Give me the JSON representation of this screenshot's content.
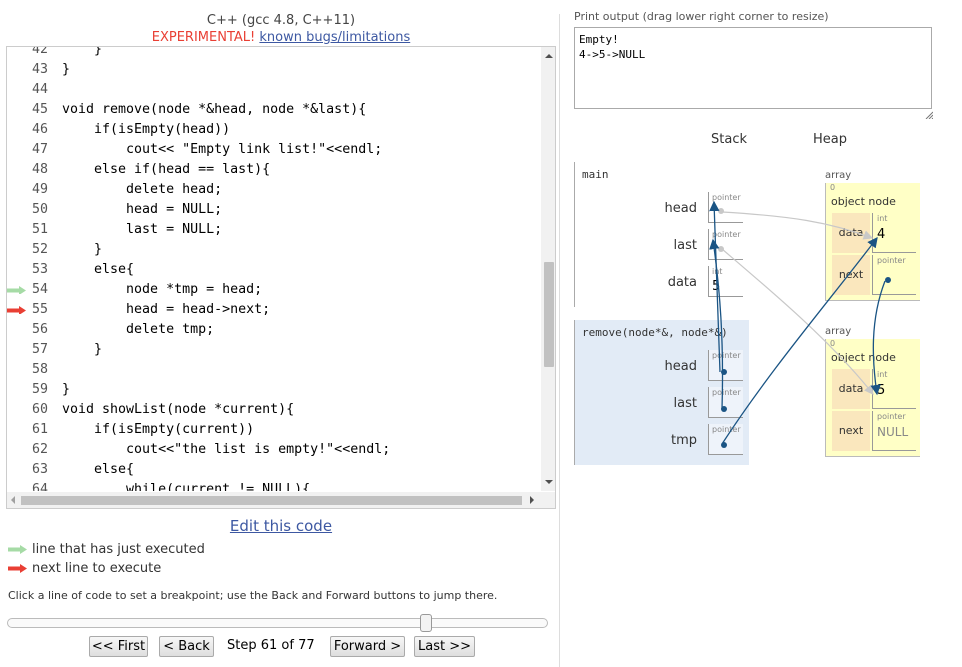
{
  "header": {
    "language": "C++ (gcc 4.8, C++11)",
    "experimental": "EXPERIMENTAL!",
    "bugs_link": "known bugs/limitations"
  },
  "code": {
    "lines": [
      {
        "n": "42",
        "text": "    }",
        "marker": ""
      },
      {
        "n": "43",
        "text": "}",
        "marker": ""
      },
      {
        "n": "44",
        "text": "",
        "marker": ""
      },
      {
        "n": "45",
        "text": "void remove(node *&head, node *&last){",
        "marker": ""
      },
      {
        "n": "46",
        "text": "    if(isEmpty(head))",
        "marker": ""
      },
      {
        "n": "47",
        "text": "        cout<< \"Empty link list!\"<<endl;",
        "marker": ""
      },
      {
        "n": "48",
        "text": "    else if(head == last){",
        "marker": ""
      },
      {
        "n": "49",
        "text": "        delete head;",
        "marker": ""
      },
      {
        "n": "50",
        "text": "        head = NULL;",
        "marker": ""
      },
      {
        "n": "51",
        "text": "        last = NULL;",
        "marker": ""
      },
      {
        "n": "52",
        "text": "    }",
        "marker": ""
      },
      {
        "n": "53",
        "text": "    else{",
        "marker": ""
      },
      {
        "n": "54",
        "text": "        node *tmp = head;",
        "marker": "just"
      },
      {
        "n": "55",
        "text": "        head = head->next;",
        "marker": "next"
      },
      {
        "n": "56",
        "text": "        delete tmp;",
        "marker": ""
      },
      {
        "n": "57",
        "text": "    }",
        "marker": ""
      },
      {
        "n": "58",
        "text": "",
        "marker": ""
      },
      {
        "n": "59",
        "text": "}",
        "marker": ""
      },
      {
        "n": "60",
        "text": "void showList(node *current){",
        "marker": ""
      },
      {
        "n": "61",
        "text": "    if(isEmpty(current))",
        "marker": ""
      },
      {
        "n": "62",
        "text": "        cout<<\"the list is empty!\"<<endl;",
        "marker": ""
      },
      {
        "n": "63",
        "text": "    else{",
        "marker": ""
      },
      {
        "n": "64",
        "text": "        while(current != NULL){",
        "marker": ""
      }
    ]
  },
  "edit_link": "Edit this code",
  "legend": {
    "just_executed": "line that has just executed",
    "next_to_execute": "next line to execute"
  },
  "hint": "Click a line of code to set a breakpoint; use the Back and Forward buttons to jump there.",
  "slider": {
    "step": 61,
    "total": 77
  },
  "nav": {
    "first": "<< First",
    "back": "< Back",
    "step_text": "Step 61 of 77",
    "forward": "Forward >",
    "last": "Last >>"
  },
  "print": {
    "label": "Print output (drag lower right corner to resize)",
    "output": "Empty!\n4->5->NULL"
  },
  "viz": {
    "stack_title": "Stack",
    "heap_title": "Heap",
    "frames": [
      {
        "name": "main",
        "vars": [
          {
            "name": "head",
            "type": "pointer",
            "value": ""
          },
          {
            "name": "last",
            "type": "pointer",
            "value": ""
          },
          {
            "name": "data",
            "type": "int",
            "value": "5"
          }
        ]
      },
      {
        "name": "remove(node*&, node*&)",
        "vars": [
          {
            "name": "head",
            "type": "pointer",
            "value": ""
          },
          {
            "name": "last",
            "type": "pointer",
            "value": ""
          },
          {
            "name": "tmp",
            "type": "pointer",
            "value": ""
          }
        ]
      }
    ],
    "heap": [
      {
        "label": "array",
        "index": "0",
        "title": "object node",
        "fields": [
          {
            "key": "data",
            "type": "int",
            "value": "4"
          },
          {
            "key": "next",
            "type": "pointer",
            "value": ""
          }
        ]
      },
      {
        "label": "array",
        "index": "0",
        "title": "object node",
        "fields": [
          {
            "key": "data",
            "type": "int",
            "value": "5"
          },
          {
            "key": "next",
            "type": "pointer",
            "value": "NULL"
          }
        ]
      }
    ]
  },
  "colors": {
    "link": "#3d58a2",
    "experimental": "#e93f34",
    "arrow_just": "#a6dba6",
    "arrow_next": "#e93f34",
    "pointer_arrow": "#1a5484",
    "heap_bg": "#ffffc6",
    "heap_key_bg": "#fae7bd",
    "frame_bg": "#e2ebf6"
  }
}
